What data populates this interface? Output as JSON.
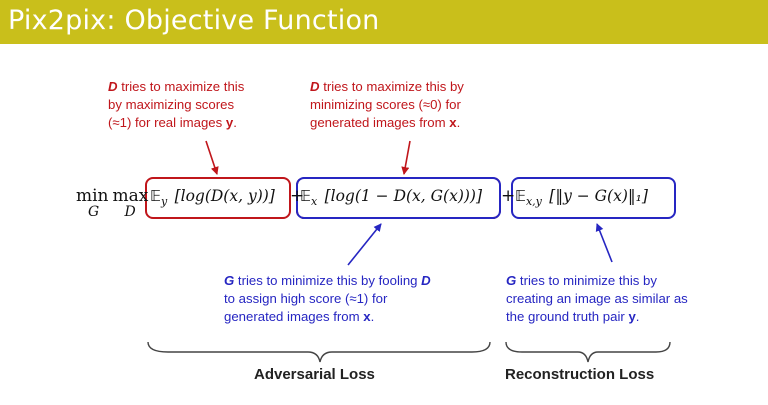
{
  "header": {
    "title": "Pix2pix: Objective Function"
  },
  "annotations": {
    "d_real": {
      "line1_bold": "D",
      "line1_rest": " tries to maximize this",
      "line2": "by maximizing scores",
      "line3_pre": "(≈1) for real images ",
      "line3_bold": "y",
      "line3_post": "."
    },
    "d_fake": {
      "line1_bold": "D",
      "line1_rest": " tries to maximize this by",
      "line2": "minimizing scores (≈0) for",
      "line3_pre": "generated images from ",
      "line3_bold": "x",
      "line3_post": "."
    },
    "g_adv": {
      "line1_bold": "G",
      "line1_mid": " tries to minimize this by fooling ",
      "line1_bold2": "D",
      "line2": "to assign high score (≈1) for",
      "line3_pre": "generated images from ",
      "line3_bold": "x",
      "line3_post": "."
    },
    "g_rec": {
      "line1_bold": "G",
      "line1_rest": " tries to minimize this by",
      "line2": "creating an image as similar as",
      "line3_pre": "the ground truth pair ",
      "line3_bold": "y",
      "line3_post": "."
    }
  },
  "equation": {
    "min": "min",
    "max": "max",
    "min_sub": "G",
    "max_sub": "D",
    "term1_sub": "y",
    "term1_body": "[log(D(x, y))]",
    "plus": "+",
    "term2_sub": "x",
    "term2_body": "[log(1 − D(x, G(x)))]",
    "term3_sub": "x,y",
    "term3_body": "[‖y − G(x)‖₁]",
    "bb_E": "𝔼"
  },
  "losses": {
    "adversarial": "Adversarial Loss",
    "reconstruction": "Reconstruction Loss"
  },
  "colors": {
    "title_bar": "#c9bf1b",
    "red": "#c0161b",
    "blue": "#2626c2"
  }
}
